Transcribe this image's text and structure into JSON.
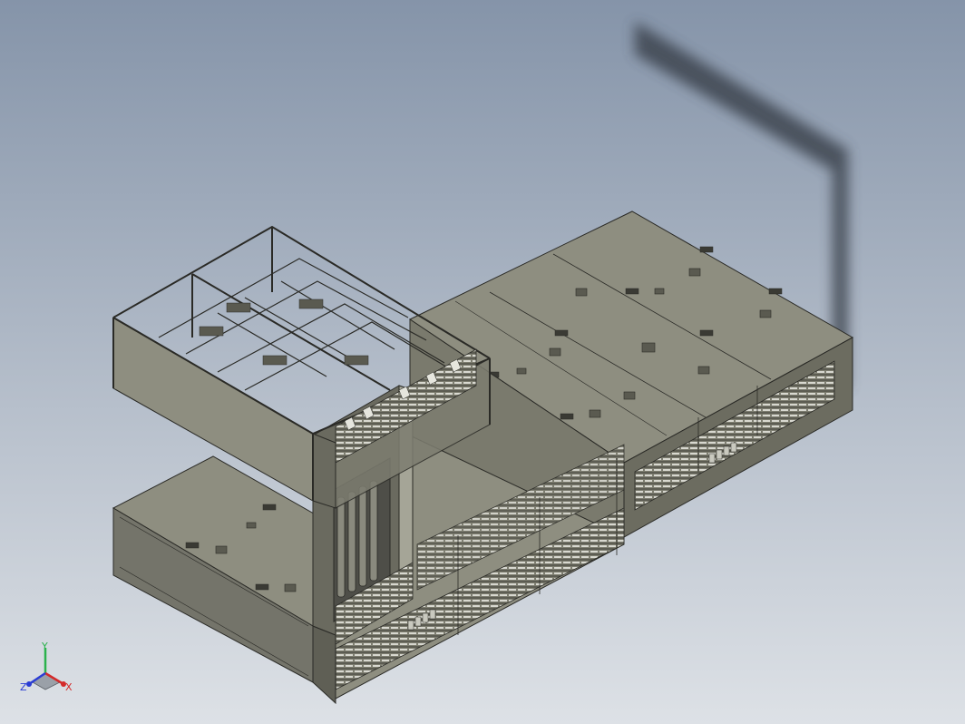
{
  "viewport": {
    "background_top": "#8594a9",
    "background_bottom": "#dde1e6"
  },
  "model": {
    "panel_color": "#8e8e80",
    "panel_dark": "#6c6c60",
    "panel_light": "#a5a597",
    "edge_color": "#2a2a26",
    "shadow_color": "#3d4450"
  },
  "triad": {
    "x_label": "X",
    "y_label": "Y",
    "z_label": "Z",
    "x_color": "#d42a2a",
    "y_color": "#2bb24c",
    "z_color": "#2a3cd4"
  }
}
